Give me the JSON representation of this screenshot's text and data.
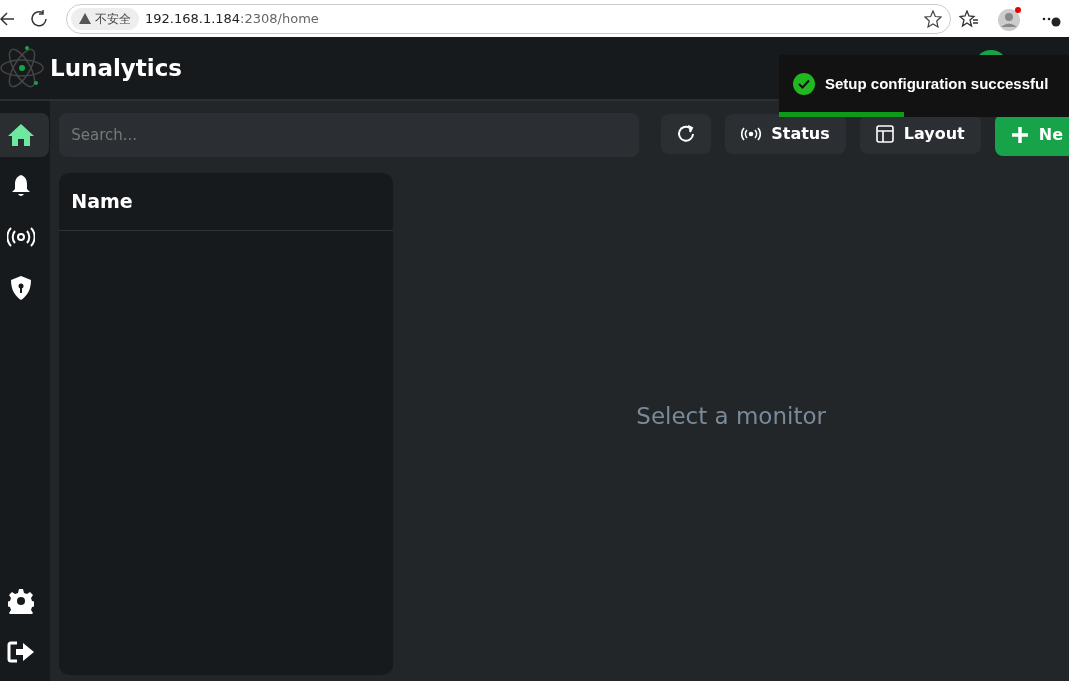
{
  "browser": {
    "security_label": "不安全",
    "url_host": "192.168.1.184",
    "url_path": ":2308/home"
  },
  "app": {
    "brand": "Lunalytics"
  },
  "sidebar": {
    "items": [
      {
        "kind": "home",
        "selected": true
      },
      {
        "kind": "bell",
        "selected": false
      },
      {
        "kind": "signal",
        "selected": false
      },
      {
        "kind": "shield",
        "selected": false
      }
    ],
    "bottom_items": [
      {
        "kind": "gear",
        "selected": false
      },
      {
        "kind": "logout",
        "selected": false
      }
    ]
  },
  "toolbar": {
    "search": {
      "placeholder": "Search..."
    },
    "buttons": [
      {
        "kind": "refresh"
      },
      {
        "kind": "status",
        "label": "Status"
      },
      {
        "kind": "layout",
        "label": "Layout"
      },
      {
        "kind": "new",
        "label": "Ne"
      }
    ]
  },
  "monitor_list": {
    "header": "Name"
  },
  "detail": {
    "empty_message": "Select a monitor"
  },
  "toast": {
    "message": "Setup configuration successful",
    "level": 0.43
  }
}
